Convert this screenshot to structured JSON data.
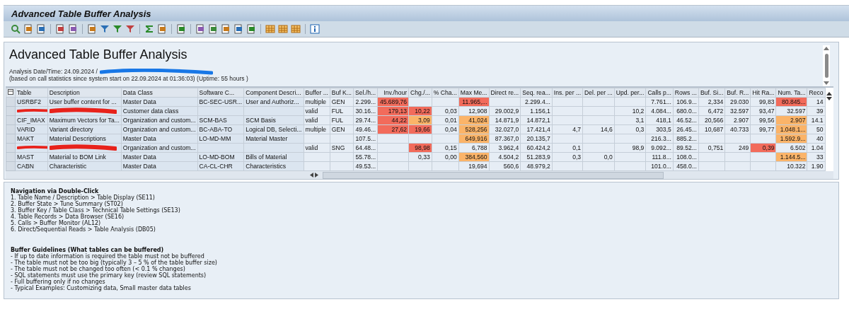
{
  "window": {
    "title": "Advanced Table Buffer Analysis"
  },
  "report": {
    "heading": "Advanced Table Buffer Analysis",
    "analysis_line": "Analysis Date/Time: 24.09.2024 /",
    "stats_line": "(based on call statistics since system start on 22.09.2024 at 01:36:03) (Uptime: 55 hours )"
  },
  "table": {
    "columns": [
      "Table",
      "Description",
      "Data Class",
      "Software C...",
      "Component Descri...",
      "Buffer ...",
      "Buf K...",
      "Sel./h...",
      "Inv./hour",
      "Chg./...",
      "% Cha...",
      "Max Me...",
      "Direct re...",
      "Seq. rea...",
      "Ins. per ...",
      "Del. per ...",
      "Upd. per...",
      "Calls p...",
      "Rows ...",
      "Buf. Si...",
      "Buf. R...",
      "Hit Ra...",
      "Num. Ta...",
      "Reco"
    ],
    "rows": [
      {
        "redacted": false,
        "cells": [
          "USRBF2",
          "User buffer content for ...",
          "Master Data",
          "BC-SEC-USR...",
          "User and Authoriz...",
          "multiple",
          "GEN",
          "2.299...",
          {
            "text": "45.689,76",
            "color": "#f26b5b"
          },
          "",
          "",
          {
            "text": "11.965,...",
            "color": "#f26b5b"
          },
          "",
          "2.299.4...",
          "",
          "",
          "",
          "7.761...",
          "106.9...",
          "2,334",
          "29.030",
          "99,83",
          {
            "text": "80.845...",
            "color": "#f26b5b"
          },
          "14"
        ]
      },
      {
        "redacted": true,
        "cells": [
          "",
          "",
          "Customer data class",
          "",
          "",
          "valid",
          "FUL",
          "30.16...",
          {
            "text": "179,13",
            "color": "#f26b5b"
          },
          {
            "text": "10,22",
            "color": "#f26b5b"
          },
          "0,03",
          "12,908",
          "29.002,9",
          "1.156,1",
          "",
          "",
          "10,2",
          "4.084...",
          "680.0...",
          "6,472",
          "32.597",
          "93,47",
          "32.597",
          "39"
        ]
      },
      {
        "redacted": false,
        "cells": [
          "CIF_IMAX",
          "Maximum Vectors for Ta...",
          "Organization and custom...",
          "SCM-BAS",
          "SCM Basis",
          "valid",
          "FUL",
          "29.74...",
          {
            "text": "44,22",
            "color": "#f26b5b"
          },
          {
            "text": "3,09",
            "color": "#fbb469"
          },
          "0,01",
          {
            "text": "41,024",
            "color": "#fbb469"
          },
          "14.871,9",
          "14.872,1",
          "",
          "",
          "3,1",
          "418,1",
          "46.52...",
          "20,566",
          "2.907",
          "99,56",
          {
            "text": "2.907",
            "color": "#fbb469"
          },
          "14.1"
        ]
      },
      {
        "redacted": false,
        "cells": [
          "VARID",
          "Variant directory",
          "Organization and custom...",
          "BC-ABA-TO",
          "Logical DB, Selecti...",
          "multiple",
          "GEN",
          "49.46...",
          {
            "text": "27,62",
            "color": "#f26b5b"
          },
          {
            "text": "19,66",
            "color": "#f26b5b"
          },
          "0,04",
          {
            "text": "528,256",
            "color": "#fbb469"
          },
          "32.027,0",
          "17.421,4",
          "4,7",
          "14,6",
          "0,3",
          "303,5",
          "26.45...",
          "10,687",
          "40.733",
          "99,77",
          {
            "text": "1.048.1...",
            "color": "#fbb469"
          },
          "50"
        ]
      },
      {
        "redacted": false,
        "cells": [
          "MAKT",
          "Material Descriptions",
          "Master Data",
          "LO-MD-MM",
          "Material Master",
          "",
          "",
          "107.5...",
          "",
          "",
          "",
          {
            "text": "649,916",
            "color": "#fbb469"
          },
          "87.367,0",
          "20.135,7",
          "",
          "",
          "",
          "216.3...",
          "885.2...",
          "",
          "",
          "",
          {
            "text": "1.592.9...",
            "color": "#fbb469"
          },
          "40"
        ]
      },
      {
        "redacted": true,
        "cells": [
          "",
          "",
          "Organization and custom...",
          "",
          "",
          "valid",
          "SNG",
          "64.48...",
          "",
          {
            "text": "98,98",
            "color": "#f26b5b"
          },
          "0,15",
          "6,788",
          "3.962,4",
          "60.424,2",
          "0,1",
          "",
          "98,9",
          "9.092...",
          "89.52...",
          "0,751",
          "249",
          {
            "text": "0,39",
            "color": "#f26b5b"
          },
          "6.502",
          "1.04"
        ]
      },
      {
        "redacted": false,
        "cells": [
          "MAST",
          "Material to BOM Link",
          "Master Data",
          "LO-MD-BOM",
          "Bills of Material",
          "",
          "",
          "55.78...",
          "",
          "0,33",
          "0,00",
          {
            "text": "384,560",
            "color": "#fbb469"
          },
          "4.504,2",
          "51.283,9",
          "0,3",
          "0,0",
          "",
          "111.8...",
          "108.0...",
          "",
          "",
          "",
          {
            "text": "1.144.5...",
            "color": "#fbb469"
          },
          "33"
        ]
      },
      {
        "redacted": false,
        "cells": [
          "CABN",
          "Characteristic",
          "Master Data",
          "CA-CL-CHR",
          "Characteristics",
          "",
          "",
          "49.53...",
          "",
          "",
          "",
          "19,694",
          "560,6",
          "48.979,2",
          "",
          "",
          "",
          "101.0...",
          "458.0...",
          "",
          "",
          "",
          "10.322",
          "1.90"
        ]
      }
    ]
  },
  "help": [
    {
      "heading": "Navigation via Double-Click",
      "lines": [
        "1. Table Name / Description > Table Display (SE11)",
        "2. Buffer State > Tune Summary (ST02)",
        "3. Buffer Key / Table Class > Technical Table Settings (SE13)",
        "4. Table Records > Data Browser (SE16)",
        "5. Calls > Buffer Monitor (AL12)",
        "6. Direct/Sequential Reads > Table Analysis (DB05)"
      ]
    },
    {
      "heading": "Buffer Guidelines (What tables can be buffered)",
      "lines": [
        "- If up to date information is required the table must not be buffered",
        "- The table must not be too big (typically 3 – 5 % of the table buffer size)",
        "- The table must not be changed too often (< 0.1 % changes)",
        "- SQL statements must use the primary key (review SQL statements)",
        "- Full buffering only if no changes",
        "- Typical Examples: Customizing data, Small master data tables"
      ]
    }
  ]
}
